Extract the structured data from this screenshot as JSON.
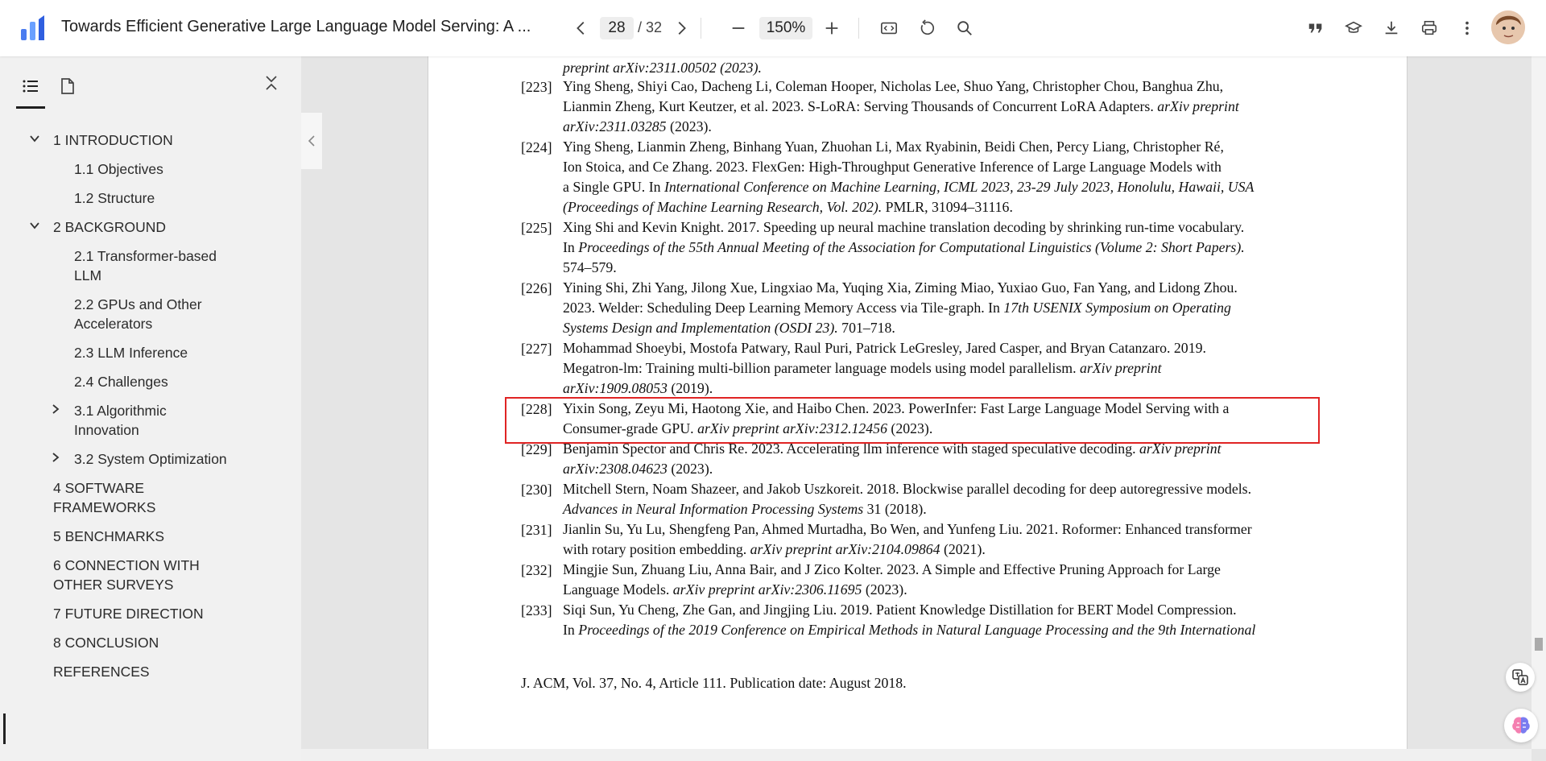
{
  "header": {
    "title": "Towards Efficient Generative Large Language Model Serving: A ...",
    "page_current": "28",
    "page_total": "/ 32",
    "zoom": "150%"
  },
  "sidebar": {
    "items": [
      {
        "label": "1 INTRODUCTION",
        "expandable": "expanded"
      },
      {
        "label": "1.1 Objectives"
      },
      {
        "label": "1.2 Structure"
      },
      {
        "label": "2 BACKGROUND",
        "expandable": "expanded"
      },
      {
        "label": "2.1 Transformer-based",
        "label2": "LLM"
      },
      {
        "label": "2.2 GPUs and Other",
        "label2": "Accelerators"
      },
      {
        "label": "2.3 LLM Inference"
      },
      {
        "label": "2.4 Challenges"
      },
      {
        "label": "3.1 Algorithmic",
        "label2": "Innovation",
        "expandable": "collapsed"
      },
      {
        "label": "3.2 System Optimization",
        "expandable": "collapsed"
      },
      {
        "label": "4 SOFTWARE",
        "label2": "FRAMEWORKS"
      },
      {
        "label": "5 BENCHMARKS"
      },
      {
        "label": "6 CONNECTION WITH",
        "label2": "OTHER SURVEYS"
      },
      {
        "label": "7 FUTURE DIRECTION"
      },
      {
        "label": "8 CONCLUSION"
      },
      {
        "label": "REFERENCES",
        "active": true
      }
    ]
  },
  "references": {
    "pre": "preprint arXiv:2311.00502 (2023).",
    "r223": {
      "num": "[223]",
      "l1": "Ying Sheng, Shiyi Cao, Dacheng Li, Coleman Hooper, Nicholas Lee, Shuo Yang, Christopher Chou, Banghua Zhu,",
      "l2a": "Lianmin Zheng, Kurt Keutzer, et al. 2023.  S-LoRA: Serving Thousands of Concurrent LoRA Adapters.  ",
      "l2b": "arXiv preprint",
      "l3a": "arXiv:2311.03285",
      "l3b": " (2023)."
    },
    "r224": {
      "num": "[224]",
      "l1": "Ying Sheng, Lianmin Zheng, Binhang Yuan, Zhuohan Li, Max Ryabinin, Beidi Chen, Percy Liang, Christopher Ré,",
      "l2": "Ion Stoica, and Ce Zhang. 2023. FlexGen: High-Throughput Generative Inference of Large Language Models with",
      "l3a": "a Single GPU. In ",
      "l3b": "International Conference on Machine Learning, ICML 2023, 23-29 July 2023, Honolulu, Hawaii, USA",
      "l4a": "(Proceedings of Machine Learning Research, Vol. 202).",
      "l4b": " PMLR, 31094–31116."
    },
    "r225": {
      "num": "[225]",
      "l1": "Xing Shi and Kevin Knight. 2017. Speeding up neural machine translation decoding by shrinking run-time vocabulary.",
      "l2a": "In ",
      "l2b": "Proceedings of the 55th Annual Meeting of the Association for Computational Linguistics (Volume 2: Short Papers).",
      "l3": "574–579."
    },
    "r226": {
      "num": "[226]",
      "l1": "Yining Shi, Zhi Yang, Jilong Xue, Lingxiao Ma, Yuqing Xia, Ziming Miao, Yuxiao Guo, Fan Yang, and Lidong Zhou.",
      "l2a": "2023. Welder: Scheduling Deep Learning Memory Access via Tile-graph. In ",
      "l2b": "17th USENIX Symposium on Operating",
      "l3a": "Systems Design and Implementation (OSDI 23).",
      "l3b": " 701–718."
    },
    "r227": {
      "num": "[227]",
      "l1": "Mohammad Shoeybi, Mostofa Patwary, Raul Puri, Patrick LeGresley, Jared Casper, and Bryan Catanzaro. 2019.",
      "l2a": "Megatron-lm: Training multi-billion parameter language models using model parallelism.  ",
      "l2b": "arXiv preprint",
      "l3a": "arXiv:1909.08053",
      "l3b": " (2019)."
    },
    "r228": {
      "num": "[228]",
      "l1": "Yixin Song, Zeyu Mi, Haotong Xie, and Haibo Chen. 2023. PowerInfer: Fast Large Language Model Serving with a",
      "l2a": "Consumer-grade GPU.  ",
      "l2b": "arXiv preprint arXiv:2312.12456",
      "l2c": " (2023)."
    },
    "r229": {
      "num": "[229]",
      "l1a": "Benjamin Spector and Chris Re. 2023. Accelerating llm inference with staged speculative decoding.  ",
      "l1b": "arXiv preprint",
      "l2a": "arXiv:2308.04623",
      "l2b": " (2023)."
    },
    "r230": {
      "num": "[230]",
      "l1": "Mitchell Stern, Noam Shazeer, and Jakob Uszkoreit. 2018. Blockwise parallel decoding for deep autoregressive models.",
      "l2a": "Advances in Neural Information Processing Systems",
      "l2b": " 31 (2018)."
    },
    "r231": {
      "num": "[231]",
      "l1": "Jianlin Su, Yu Lu, Shengfeng Pan, Ahmed Murtadha, Bo Wen, and Yunfeng Liu. 2021. Roformer: Enhanced transformer",
      "l2a": "with rotary position embedding.  ",
      "l2b": "arXiv preprint arXiv:2104.09864",
      "l2c": " (2021)."
    },
    "r232": {
      "num": "[232]",
      "l1": "Mingjie Sun, Zhuang Liu, Anna Bair, and J Zico Kolter. 2023.  A Simple and Effective Pruning Approach for Large",
      "l2a": "Language Models.  ",
      "l2b": "arXiv preprint arXiv:2306.11695",
      "l2c": " (2023)."
    },
    "r233": {
      "num": "[233]",
      "l1": "Siqi Sun, Yu Cheng, Zhe Gan, and Jingjing Liu. 2019. Patient Knowledge Distillation for BERT Model Compression.",
      "l2a": "In ",
      "l2b": "Proceedings of the 2019 Conference on Empirical Methods in Natural Language Processing and the 9th International"
    }
  },
  "footer": "J. ACM, Vol. 37, No. 4, Article 111. Publication date: August 2018."
}
